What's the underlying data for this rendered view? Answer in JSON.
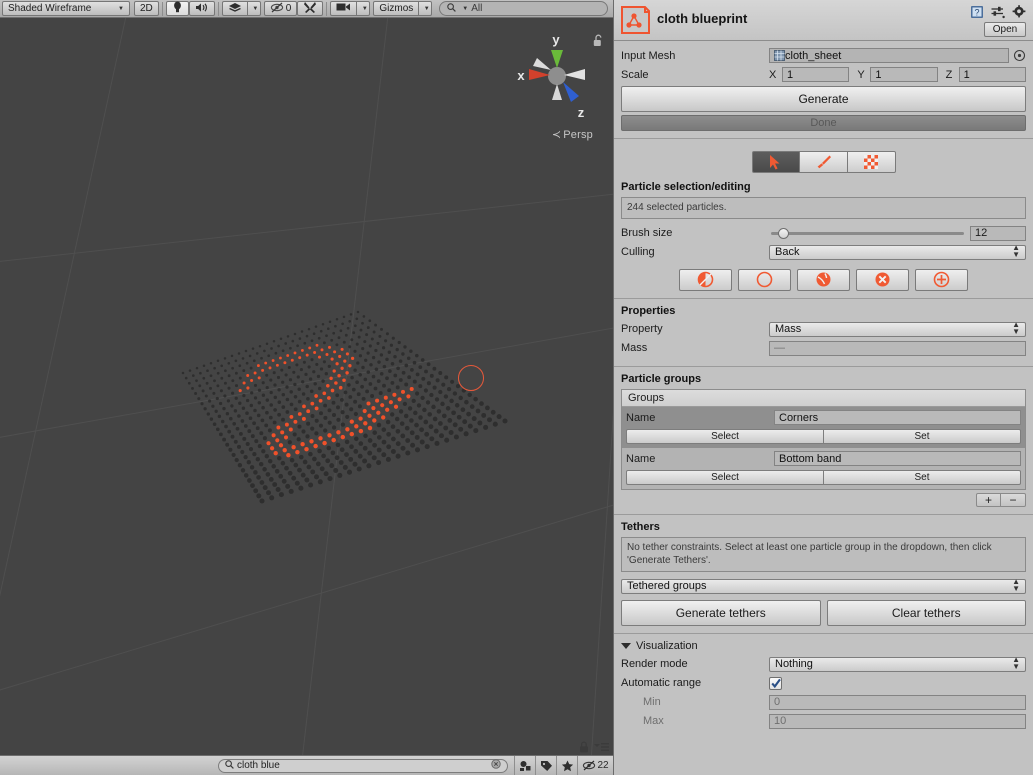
{
  "scene_toolbar": {
    "draw_mode": "Shaded Wireframe",
    "mode_2d": "2D",
    "lighting_icon": "lightbulb-icon",
    "audio_icon": "speaker-icon",
    "fx_icon": "effects-icon",
    "hidden_objects_icon": "eye-off-icon",
    "hidden_objects_count": "0",
    "tools_icon": "tools-icon",
    "camera_icon": "camera-icon",
    "gizmos_label": "Gizmos",
    "search_placeholder": "All",
    "search_icon": "search-icon"
  },
  "viewport": {
    "axis_x_label": "x",
    "axis_y_label": "y",
    "axis_z_label": "z",
    "projection_label": "Persp",
    "projection_arrow": "≺",
    "lock_icon": "unlock-icon",
    "background_color": "#444444",
    "particle_unselected_color": "#2e2e2e",
    "particle_selected_color": "#f0512a",
    "brush_ring_color": "#e8593a"
  },
  "scene_bottom": {
    "lock_icon": "lock-icon",
    "menu_icon": "hamburger-menu-icon",
    "project_search_value": "cloth blue",
    "project_search_icon": "search-icon",
    "clear_icon": "clear-circle-icon",
    "status_icons": [
      {
        "name": "objects-icon"
      },
      {
        "name": "tag-icon"
      },
      {
        "name": "star-icon"
      }
    ],
    "hidden_count_icon": "eye-off-icon",
    "hidden_count": "22"
  },
  "inspector": {
    "icon": "blueprint-icon",
    "title": "cloth blueprint",
    "header_icons": [
      {
        "name": "help-book-icon"
      },
      {
        "name": "preset-icon"
      },
      {
        "name": "gear-icon"
      }
    ],
    "open_label": "Open",
    "input_mesh": {
      "label": "Input Mesh",
      "value": "cloth_sheet",
      "mesh_icon": "mesh-icon",
      "select_icon": "object-picker-icon"
    },
    "scale": {
      "label": "Scale",
      "axes": [
        {
          "axis": "X",
          "value": "1"
        },
        {
          "axis": "Y",
          "value": "1"
        },
        {
          "axis": "Z",
          "value": "1"
        }
      ]
    },
    "generate_label": "Generate",
    "done_label": "Done",
    "modes": [
      {
        "name": "select-mode-icon",
        "selected": true
      },
      {
        "name": "paint-mode-icon",
        "selected": false
      },
      {
        "name": "property-mode-icon",
        "selected": false
      }
    ],
    "particle_section": {
      "title": "Particle selection/editing",
      "status": "244 selected particles.",
      "brush_size_label": "Brush size",
      "brush_size_value": "12",
      "brush_size_fill_percent": 3.5,
      "culling_label": "Culling",
      "culling_value": "Back",
      "actions": [
        {
          "name": "invert-selection-icon"
        },
        {
          "name": "clear-selection-icon"
        },
        {
          "name": "select-all-icon"
        },
        {
          "name": "remove-particles-icon"
        },
        {
          "name": "add-particles-icon"
        }
      ]
    },
    "properties_section": {
      "title": "Properties",
      "property_label": "Property",
      "property_value": "Mass",
      "mass_label": "Mass",
      "mass_value": "—"
    },
    "particle_groups_section": {
      "title": "Particle groups",
      "list_header": "Groups",
      "name_label": "Name",
      "select_label": "Select",
      "set_label": "Set",
      "groups": [
        {
          "name": "Corners",
          "selected": true
        },
        {
          "name": "Bottom band",
          "selected": false
        }
      ],
      "add_label": "+",
      "remove_label": "−"
    },
    "tethers_section": {
      "title": "Tethers",
      "help": "No tether constraints. Select at least one particle group in the dropdown, then click 'Generate Tethers'.",
      "dropdown_value": "Tethered groups",
      "generate_label": "Generate tethers",
      "clear_label": "Clear tethers"
    },
    "visualization_section": {
      "title": "Visualization",
      "render_mode_label": "Render mode",
      "render_mode_value": "Nothing",
      "automatic_range_label": "Automatic range",
      "automatic_range_checked": true,
      "min_label": "Min",
      "min_value": "0",
      "max_label": "Max",
      "max_value": "10"
    }
  }
}
